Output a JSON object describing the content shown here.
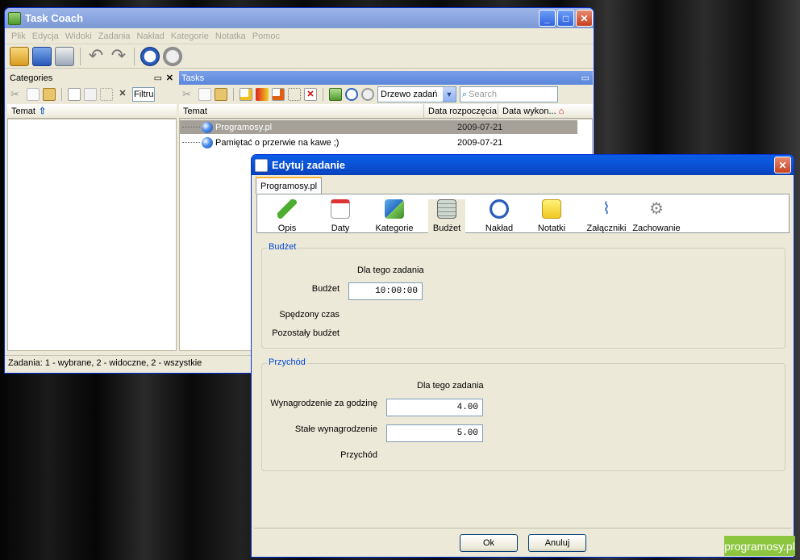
{
  "main": {
    "title": "Task Coach",
    "menu": [
      "Plik",
      "Edycja",
      "Widoki",
      "Zadania",
      "Nakład",
      "Kategorie",
      "Notatka",
      "Pomoc"
    ],
    "categories": {
      "header": "Categories",
      "filter_placeholder": "Filtru",
      "column": "Temat"
    },
    "tasks": {
      "header": "Tasks",
      "view_select": "Drzewo zadań",
      "search_placeholder": "Search",
      "columns": [
        "Temat",
        "Data rozpoczęcia",
        "Data wykon..."
      ],
      "rows": [
        {
          "name": "Programosy.pl",
          "date": "2009-07-21"
        },
        {
          "name": "Pamiętać o przerwie na kawe ;)",
          "date": "2009-07-21"
        }
      ]
    },
    "status": "Zadania: 1 - wybrane, 2 - widoczne, 2 - wszystkie"
  },
  "dialog": {
    "title": "Edytuj zadanie",
    "tab": "Programosy.pl",
    "pages": [
      "Opis",
      "Daty",
      "Kategorie",
      "Budżet",
      "Nakład",
      "Notatki",
      "Załączniki",
      "Zachowanie"
    ],
    "budget_group": {
      "title": "Budżet",
      "column": "Dla tego zadania",
      "budget_label": "Budżet",
      "budget_value": "10:00:00",
      "spent_label": "Spędzony czas",
      "remaining_label": "Pozostały budżet"
    },
    "revenue_group": {
      "title": "Przychód",
      "column": "Dla tego zadania",
      "hourly_label": "Wynagrodzenie za godzinę",
      "hourly_value": "4.00",
      "fixed_label": "Stałe wynagrodzenie",
      "fixed_value": "5.00",
      "revenue_label": "Przychód"
    },
    "ok": "Ok",
    "cancel": "Anuluj"
  },
  "watermark": "programosy.pl"
}
